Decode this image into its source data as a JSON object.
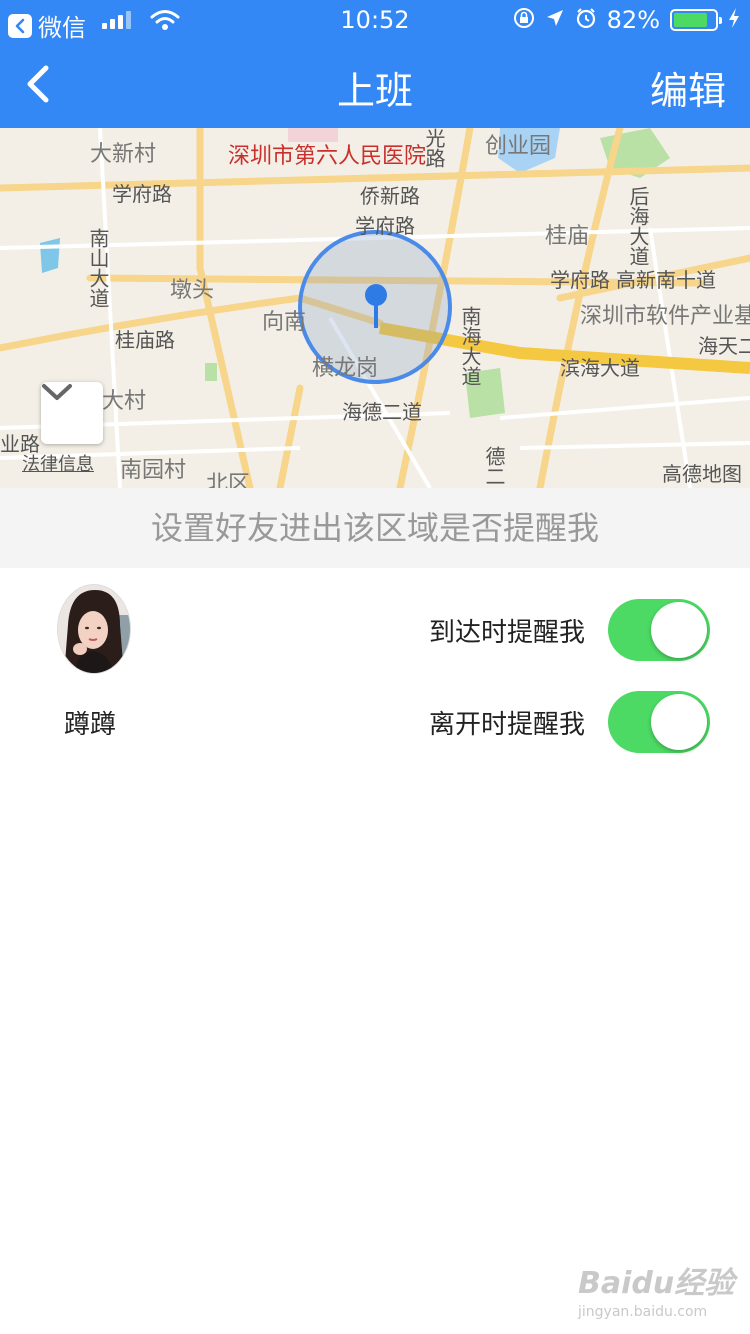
{
  "status_bar": {
    "back_app": "微信",
    "time": "10:52",
    "battery": "82%",
    "battery_level": 0.82
  },
  "nav": {
    "title": "上班",
    "edit_label": "编辑"
  },
  "map": {
    "labels": {
      "hospital": "深圳市第六人民医院",
      "daxincun": "大新村",
      "xuefulu_left": "学府路",
      "xuefulu_mid": "学府路",
      "xuefulu_right": "学府路",
      "qiaoxinlu": "侨新路",
      "chuangyeyuan": "创业园",
      "guimiao": "桂庙",
      "gaoxinnan": "高新南十道",
      "software_park": "深圳市软件产业基",
      "haitian": "海天二",
      "dunwei": "墩头",
      "xiangnan": "向南",
      "guimiaolu": "桂庙路",
      "henglonggang": "横龙岗",
      "binhai": "滨海大道",
      "haide": "海德二道",
      "nanyuancun": "南园村",
      "beiqu": "北区",
      "dacun": "大村",
      "xiaolu": "业路",
      "nanhaidadao": "南海大道",
      "houhaidadao": "后海大道",
      "nanshandadao": "南山大道",
      "guangming": "光路",
      "deer": "德二"
    },
    "legal_link": "法律信息",
    "provider": "高德地图"
  },
  "hint": "设置好友进出该区域是否提醒我",
  "friend": {
    "name": "蹲蹲"
  },
  "options": [
    {
      "label": "到达时提醒我",
      "on": true
    },
    {
      "label": "离开时提醒我",
      "on": true
    }
  ],
  "watermark": {
    "title": "Baidu经验",
    "sub": "jingyan.baidu.com"
  }
}
